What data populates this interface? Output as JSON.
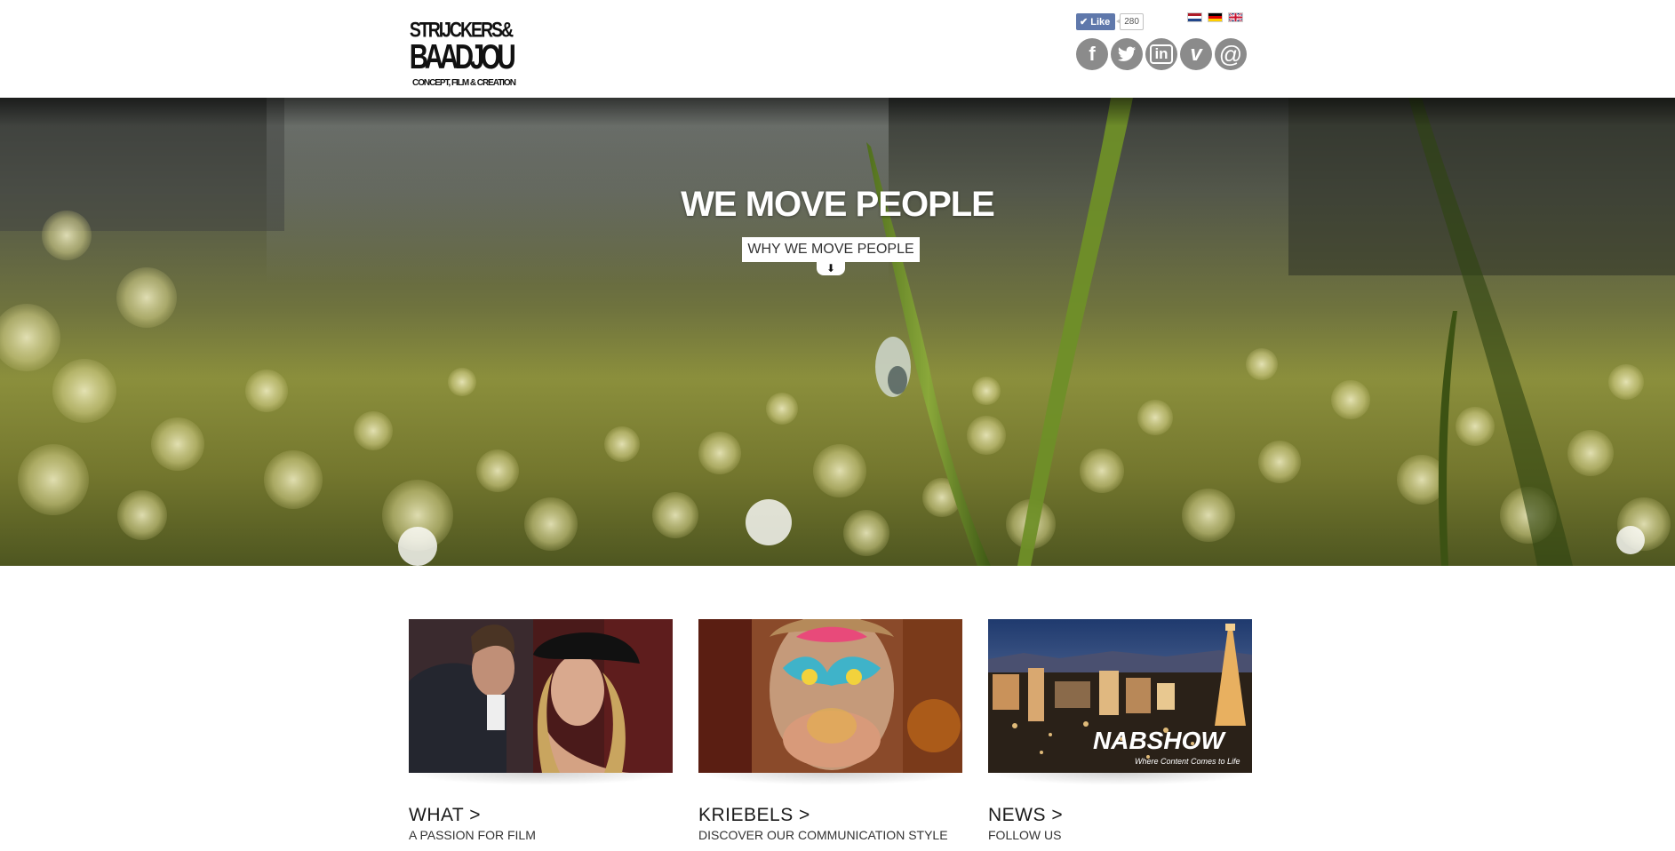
{
  "brand": {
    "logo_line1": "STRIJCKERS&",
    "logo_line2": "BAADJOU",
    "logo_line3": "CONCEPT, FILM & CREATION"
  },
  "facebook": {
    "like_label": "Like",
    "count": "280",
    "color": "#5f78ab"
  },
  "languages": [
    "nl-flag-icon",
    "de-flag-icon",
    "en-flag-icon"
  ],
  "social": [
    {
      "icon": "facebook-icon",
      "glyph": "f"
    },
    {
      "icon": "twitter-icon",
      "glyph": "t"
    },
    {
      "icon": "linkedin-icon",
      "glyph": "in"
    },
    {
      "icon": "vimeo-icon",
      "glyph": "v"
    },
    {
      "icon": "email-icon",
      "glyph": "@"
    }
  ],
  "hero": {
    "title": "WE MOVE PEOPLE",
    "button_label": "WHY WE MOVE PEOPLE",
    "arrow_icon": "arrow-down-icon"
  },
  "cards": [
    {
      "title": "WHAT >",
      "subtitle": "A PASSION FOR FILM"
    },
    {
      "title": "KRIEBELS >",
      "subtitle": "DISCOVER OUR COMMUNICATION STYLE"
    },
    {
      "title": "NEWS >",
      "subtitle": "FOLLOW US",
      "thumb_logo": "NABSHOW",
      "thumb_tagline": "Where Content Comes to Life"
    }
  ]
}
